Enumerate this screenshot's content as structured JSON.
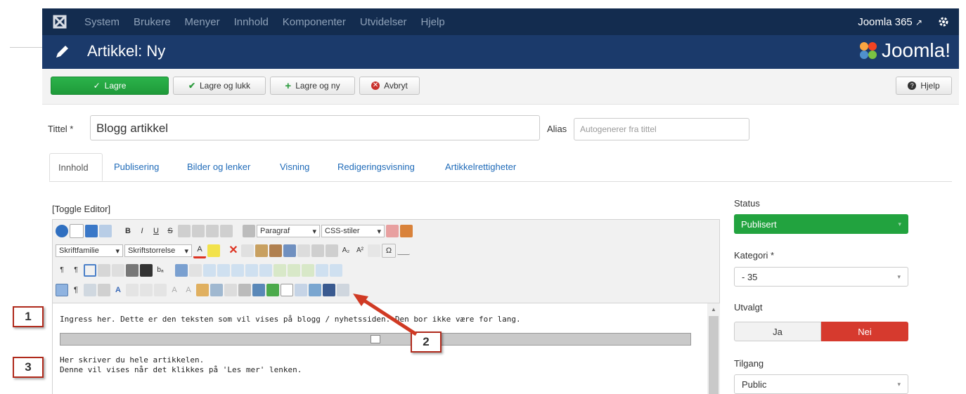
{
  "topbar": {
    "menu": [
      "System",
      "Brukere",
      "Menyer",
      "Innhold",
      "Komponenter",
      "Utvidelser",
      "Hjelp"
    ],
    "site_name": "Joomla 365",
    "icons": [
      "joomla-logo-icon",
      "external-link-icon",
      "gear-icon"
    ]
  },
  "titlebar": {
    "title": "Artikkel: Ny",
    "brand": "Joomla!"
  },
  "toolbar": {
    "save_label": "Lagre",
    "save_close_label": "Lagre og lukk",
    "save_new_label": "Lagre og ny",
    "cancel_label": "Avbryt",
    "help_label": "Hjelp"
  },
  "form": {
    "title_label": "Tittel *",
    "title_value": "Blogg artikkel",
    "alias_label": "Alias",
    "alias_placeholder": "Autogenerer fra tittel"
  },
  "tabs": [
    "Innhold",
    "Publisering",
    "Bilder og lenker",
    "Visning",
    "Redigeringsvisning",
    "Artikkelrettigheter"
  ],
  "editor": {
    "toggle": "[Toggle Editor]",
    "format_select": "Paragraf",
    "css_select": "CSS-stiler",
    "font_family_select": "Skriftfamilie",
    "font_size_select": "Skriftstorrelse",
    "line1": "Ingress her. Dette er den teksten som vil vises på blogg / nyhetssiden. Den bor ikke være for lang.",
    "line2": "Her skriver du hele artikkelen.",
    "line3": "Denne vil vises når det klikkes på 'Les mer' lenken."
  },
  "callouts": [
    "1",
    "2",
    "3"
  ],
  "sidebar": {
    "status_label": "Status",
    "status_value": "Publisert",
    "category_label": "Kategori *",
    "category_value": "- 35",
    "featured_label": "Utvalgt",
    "featured_yes": "Ja",
    "featured_no": "Nei",
    "access_label": "Tilgang",
    "access_value": "Public"
  },
  "colors": {
    "topbar": "#132c4f",
    "titlebar": "#1b3a6b",
    "green": "#22a33f",
    "red": "#d63a2e",
    "callout_border": "#b02a1c"
  }
}
